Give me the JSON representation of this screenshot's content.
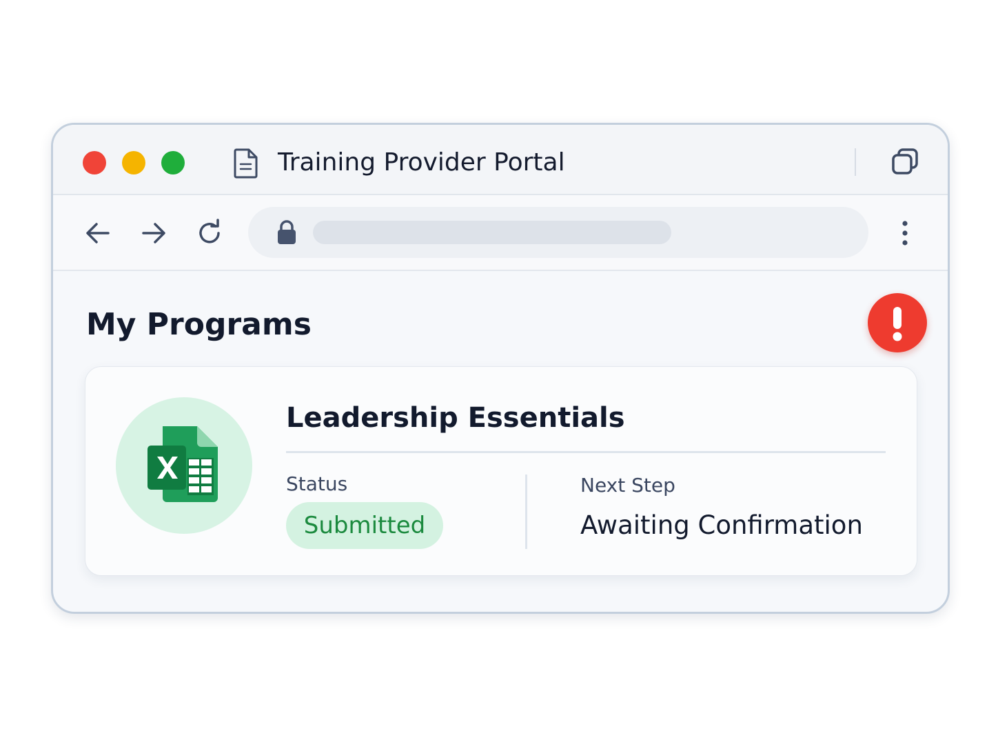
{
  "window": {
    "title": "Training Provider Portal",
    "icon": "document-icon",
    "controls": {
      "close_color": "#f04438",
      "minimize_color": "#f5b400",
      "maximize_color": "#1fae3b",
      "restore_icon": "restore-window-icon"
    }
  },
  "toolbar": {
    "back_icon": "arrow-left-icon",
    "forward_icon": "arrow-right-icon",
    "reload_icon": "reload-icon",
    "address_lock_icon": "lock-icon",
    "address_value": "",
    "menu_icon": "kebab-menu-icon"
  },
  "page": {
    "title": "My Programs",
    "alert_icon": "exclamation-icon",
    "alert_color": "#ee3b2f"
  },
  "program": {
    "name": "Leadership Essentials",
    "icon": "excel-spreadsheet-icon",
    "status_label": "Status",
    "status_value": "Submitted",
    "status_color": "#1b8a3e",
    "next_step_label": "Next Step",
    "next_step_value": "Awaiting Confirmation"
  }
}
